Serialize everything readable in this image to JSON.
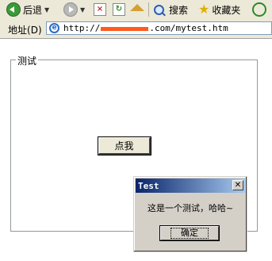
{
  "toolbar": {
    "back_label": "后退",
    "search_label": "搜索",
    "favorites_label": "收藏夹",
    "icons": [
      "back-icon",
      "forward-icon",
      "stop-icon",
      "refresh-icon",
      "home-icon",
      "search-icon",
      "favorites-icon",
      "media-icon"
    ]
  },
  "address": {
    "label_prefix": "地址",
    "label_accel": "(D)",
    "url_prefix": "http://",
    "url_suffix": ".com/mytest.htm",
    "redaction_color": "#ff5a1f"
  },
  "page": {
    "fieldset_legend": "测试",
    "click_button_label": "点我"
  },
  "dialog": {
    "title": "Test",
    "close_glyph": "✕",
    "message": "这是一个测试，哈哈~",
    "ok_label": "确定",
    "title_gradient": [
      "#0a246a",
      "#a6caf0"
    ]
  }
}
